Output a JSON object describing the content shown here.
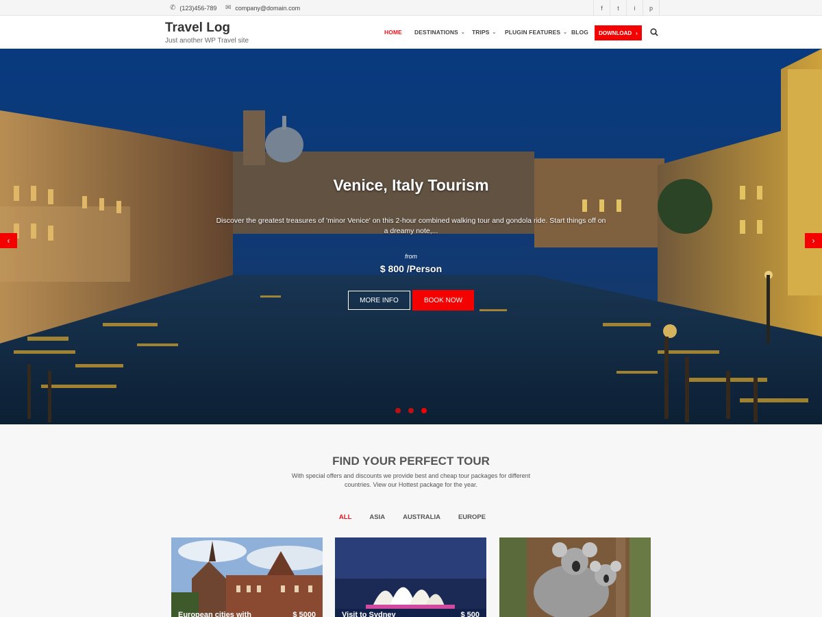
{
  "topbar": {
    "phone": "(123)456-789",
    "email": "company@domain.com",
    "socials": [
      "f",
      "t",
      "i",
      "p"
    ]
  },
  "header": {
    "site_title": "Travel Log",
    "tagline": "Just another WP Travel site",
    "nav": {
      "home": "HOME",
      "destinations": "DESTINATIONS",
      "trips": "TRIPS",
      "plugin_features": "PLUGIN FEATURES",
      "blog": "BLOG"
    },
    "download_label": "DOWNLOAD"
  },
  "hero": {
    "title": "Venice, Italy Tourism",
    "description": "Discover the greatest treasures of 'minor Venice' on this 2-hour combined walking tour and gondola ride. Start things off on a dreamy note,...",
    "from_label": "from",
    "price": "$ 800 /Person",
    "more_info": "MORE INFO",
    "book_now": "BOOK NOW",
    "slides": 3,
    "active_slide": 3
  },
  "tours": {
    "title": "FIND YOUR PERFECT TOUR",
    "subtitle": "With special offers and discounts we provide best and cheap tour packages for different countries. View our Hottest package for the year.",
    "filters": [
      "ALL",
      "ASIA",
      "AUSTRALIA",
      "EUROPE"
    ],
    "active_filter": "ALL",
    "cards": [
      {
        "name": "European cities with",
        "price": "$ 5000"
      },
      {
        "name": "Visit to Sydney",
        "price": "$ 500"
      },
      {
        "name": "",
        "price": ""
      }
    ]
  },
  "colors": {
    "accent": "#f40101",
    "active_nav": "#e4141c"
  }
}
